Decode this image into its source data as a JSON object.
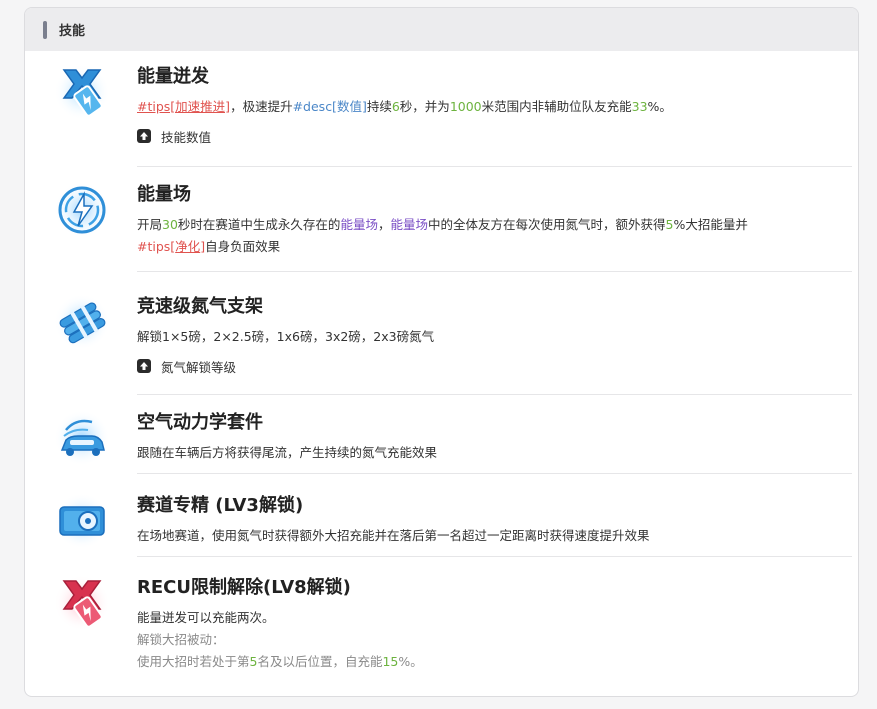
{
  "header": {
    "title": "技能"
  },
  "skills": [
    {
      "name": "能量迸发",
      "desc": [
        "#tips[加速推进]",
        "，极速提升",
        "#desc[数值]",
        "持续",
        "6",
        "秒，并为",
        "1000",
        "米范围内非辅助位队友充能",
        "33",
        "%。"
      ],
      "sub": "技能数值"
    },
    {
      "name": "能量场",
      "line1": [
        "开局",
        "30",
        "秒时在赛道中生成永久存在的",
        "能量场",
        "，",
        "能量场",
        "中的全体友方在每次使用氮气时，额外获得",
        "5",
        "%大招能量并"
      ],
      "line2": [
        "#tips[",
        "净化",
        "]",
        "自身负面效果"
      ]
    },
    {
      "name": "竞速级氮气支架",
      "desc": "解锁1×5磅，2×2.5磅，1x6磅，3x2磅，2x3磅氮气",
      "sub": "氮气解锁等级"
    },
    {
      "name": "空气动力学套件",
      "desc": "跟随在车辆后方将获得尾流，产生持续的氮气充能效果"
    },
    {
      "name": "赛道专精 (LV3解锁)",
      "desc": "在场地赛道，使用氮气时获得额外大招充能并在落后第一名超过一定距离时获得速度提升效果"
    },
    {
      "name": "RECU限制解除(LV8解锁)",
      "desc1": "能量迸发可以充能两次。",
      "desc2": "解锁大招被动：",
      "desc3": [
        "使用大招时若处于第",
        "5",
        "名及以后位置，自充能",
        "15",
        "%。"
      ]
    }
  ],
  "icons": [
    "lightning-battery-icon",
    "energy-field-icon",
    "nitro-tanks-icon",
    "aero-kit-icon",
    "tire-icon",
    "recu-lightning-icon"
  ],
  "colors": {
    "blue_icon": "#2f8fd8",
    "red_icon": "#d8324f",
    "green_value": "#6db33f",
    "red_tag": "#e0534f",
    "blue_tag": "#4b87c8",
    "purple_term": "#7a4ec5"
  }
}
